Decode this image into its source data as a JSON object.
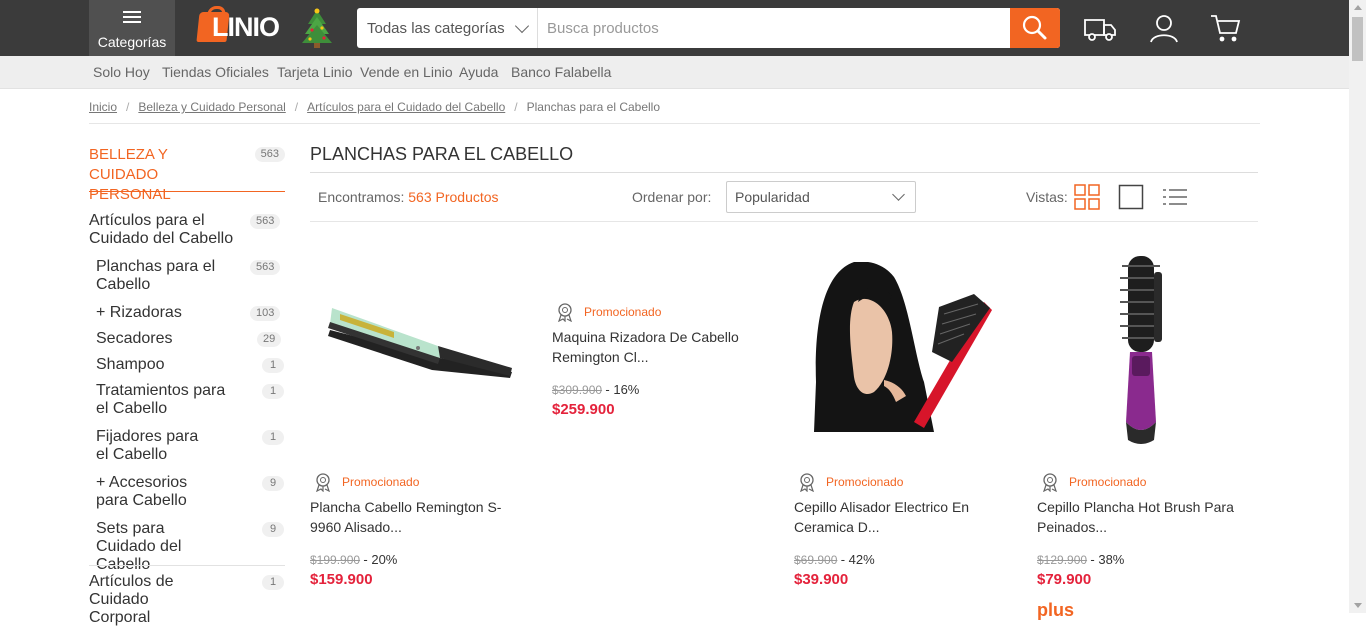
{
  "header": {
    "categories_label": "Categorías",
    "logo_text": "LINIO",
    "search": {
      "category_value": "Todas las categorías",
      "placeholder": "Busca productos"
    }
  },
  "subnav": [
    "Solo Hoy",
    "Tiendas Oficiales",
    "Tarjeta Linio",
    "Vende en Linio",
    "Ayuda",
    "Banco Falabella"
  ],
  "breadcrumb": [
    "Inicio",
    "Belleza y Cuidado Personal",
    "Artículos para el Cuidado del Cabello",
    "Planchas para el Cabello"
  ],
  "sidebar": {
    "root_label": "BELLEZA Y CUIDADO PERSONAL",
    "root_count": "563",
    "items": [
      {
        "label": "Artículos para el Cuidado del Cabello",
        "count": "563"
      },
      {
        "label": "Planchas para el Cabello",
        "count": "563"
      },
      {
        "label": "+  Rizadoras",
        "count": "103"
      },
      {
        "label": "Secadores",
        "count": "29"
      },
      {
        "label": "Shampoo",
        "count": "1"
      },
      {
        "label": "Tratamientos para el Cabello",
        "count": "1"
      },
      {
        "label": "Fijadores para el Cabello",
        "count": "1"
      },
      {
        "label": "+  Accesorios para Cabello",
        "count": "9"
      },
      {
        "label": "Sets para Cuidado del Cabello",
        "count": "9"
      },
      {
        "label": "Artículos de Cuidado Corporal",
        "count": "1"
      }
    ]
  },
  "main": {
    "title": "PLANCHAS PARA EL CABELLO",
    "found_prefix": "Encontramos:",
    "found_count": "563 Productos",
    "sort_label": "Ordenar por:",
    "sort_value": "Popularidad",
    "views_label": "Vistas:"
  },
  "products": [
    {
      "promo": "Promocionado",
      "name": "Plancha Cabello Remington S-9960 Alisado...",
      "old_price": "$199.900",
      "discount": "- 20%",
      "price": "$159.900"
    },
    {
      "promo": "Promocionado",
      "name": "Maquina Rizadora De Cabello Remington Cl...",
      "old_price": "$309.900",
      "discount": "- 16%",
      "price": "$259.900"
    },
    {
      "promo": "Promocionado",
      "name": "Cepillo Alisador Electrico En Ceramica D...",
      "old_price": "$69.900",
      "discount": "- 42%",
      "price": "$39.900"
    },
    {
      "promo": "Promocionado",
      "name": "Cepillo Plancha Hot Brush Para Peinados...",
      "old_price": "$129.900",
      "discount": "- 38%",
      "price": "$79.900"
    }
  ],
  "plus_label": "plus",
  "colors": {
    "accent": "#f26522",
    "price": "#e4223b",
    "header": "#3b3b3b"
  }
}
